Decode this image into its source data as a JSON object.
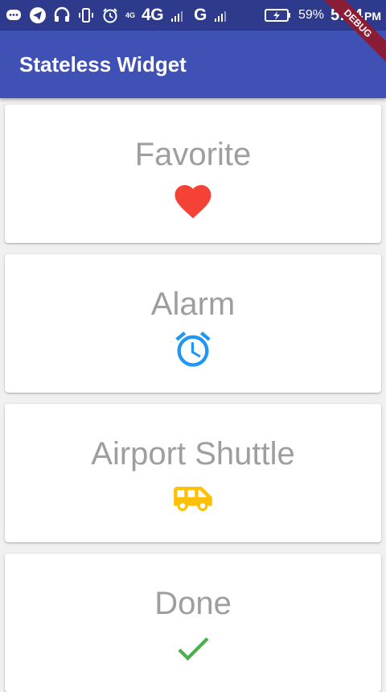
{
  "status_bar": {
    "network_label": "4G",
    "network_small": "4G",
    "network_g": "G",
    "battery_percent": "59%",
    "time": "5:44",
    "ampm": "PM"
  },
  "app_bar": {
    "title": "Stateless Widget"
  },
  "debug_banner": "DEBUG",
  "cards": [
    {
      "label": "Favorite",
      "icon": "heart-icon",
      "color": "#f44336"
    },
    {
      "label": "Alarm",
      "icon": "alarm-icon",
      "color": "#2196f3"
    },
    {
      "label": "Airport Shuttle",
      "icon": "airport-shuttle-icon",
      "color": "#ffc107"
    },
    {
      "label": "Done",
      "icon": "check-icon",
      "color": "#4caf50"
    }
  ],
  "colors": {
    "app_bar": "#3f51b5",
    "status_bar": "#2e3a8c",
    "label_text": "#9e9e9e",
    "debug_banner": "#8a1c35"
  }
}
